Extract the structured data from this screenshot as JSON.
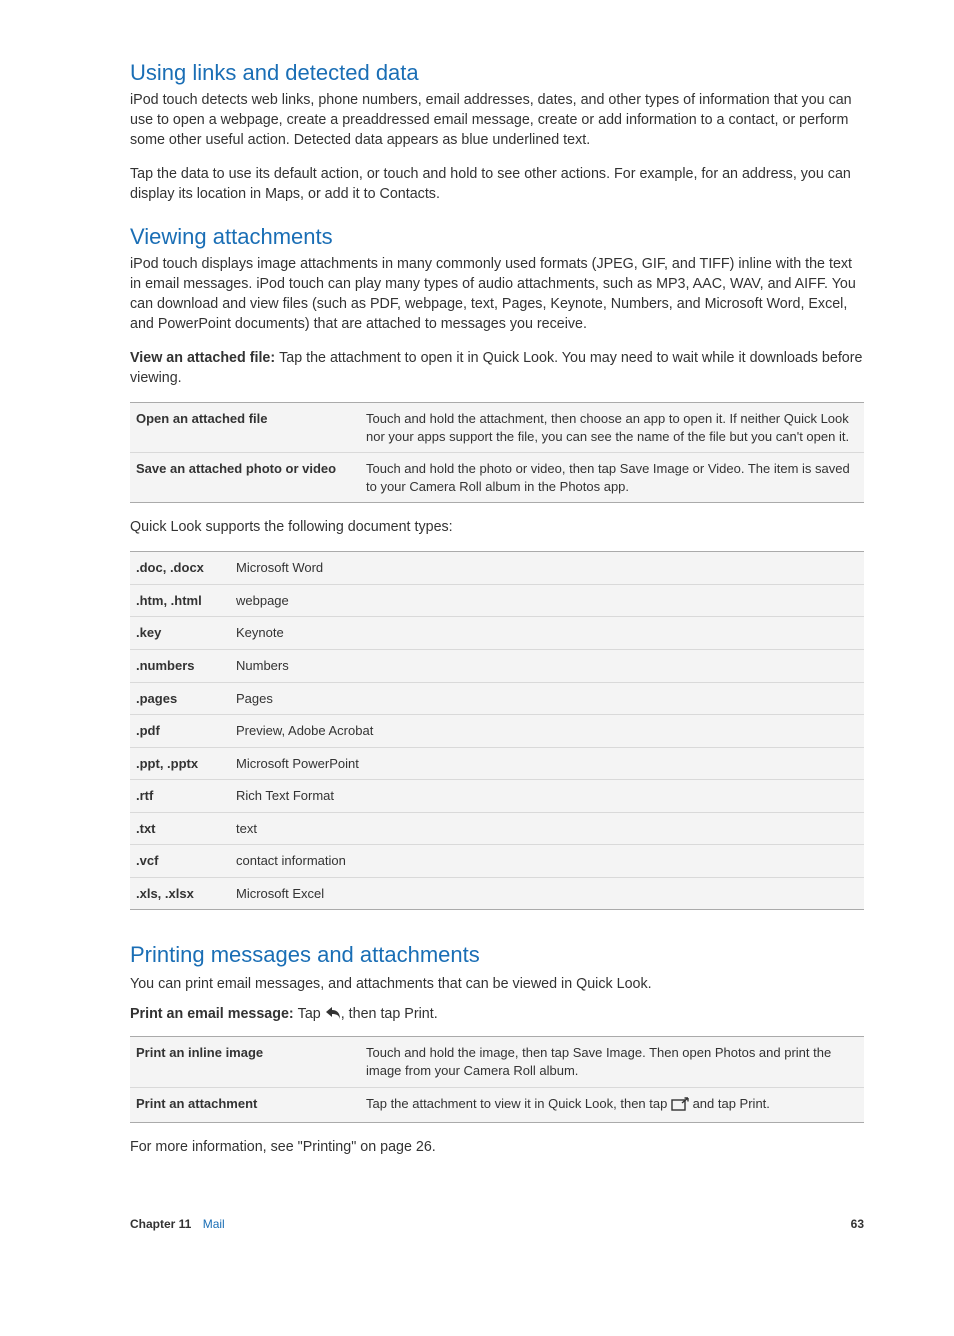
{
  "section1": {
    "heading": "Using links and detected data",
    "p1": "iPod touch detects web links, phone numbers, email addresses, dates, and other types of information that you can use to open a webpage, create a preaddressed email message, create or add information to a contact, or perform some other useful action. Detected data appears as blue underlined text.",
    "p2": "Tap the data to use its default action, or touch and hold to see other actions. For example, for an address, you can display its location in Maps, or add it to Contacts."
  },
  "section2": {
    "heading": "Viewing attachments",
    "p1": "iPod touch displays image attachments in many commonly used formats (JPEG, GIF, and TIFF) inline with the text in email messages. iPod touch can play many types of audio attachments, such as MP3, AAC, WAV, and AIFF. You can download and view files (such as PDF, webpage, text, Pages, Keynote, Numbers, and Microsoft Word, Excel, and PowerPoint documents) that are attached to messages you receive.",
    "view_label": "View an attached file:  ",
    "view_text": "Tap the attachment to open it in Quick Look. You may need to wait while it downloads before viewing.",
    "table": [
      {
        "label": "Open an attached file",
        "desc": "Touch and hold the attachment, then choose an app to open it. If neither Quick Look nor your apps support the file, you can see the name of the file but you can't open it."
      },
      {
        "label": "Save an attached photo or video",
        "desc": "Touch and hold the photo or video, then tap Save Image or Video. The item is saved to your Camera Roll album in the Photos app."
      }
    ],
    "quicklook_intro": "Quick Look supports the following document types:",
    "types": [
      {
        "ext": ".doc, .docx",
        "desc": "Microsoft Word"
      },
      {
        "ext": ".htm, .html",
        "desc": "webpage"
      },
      {
        "ext": ".key",
        "desc": "Keynote"
      },
      {
        "ext": ".numbers",
        "desc": "Numbers"
      },
      {
        "ext": ".pages",
        "desc": "Pages"
      },
      {
        "ext": ".pdf",
        "desc": "Preview, Adobe Acrobat"
      },
      {
        "ext": ".ppt, .pptx",
        "desc": "Microsoft PowerPoint"
      },
      {
        "ext": ".rtf",
        "desc": "Rich Text Format"
      },
      {
        "ext": ".txt",
        "desc": "text"
      },
      {
        "ext": ".vcf",
        "desc": "contact information"
      },
      {
        "ext": ".xls, .xlsx",
        "desc": "Microsoft Excel"
      }
    ]
  },
  "section3": {
    "heading": "Printing messages and attachments",
    "p1": "You can print email messages, and attachments that can be viewed in Quick Look.",
    "print_label": "Print an email message:  ",
    "print_text_before": "Tap ",
    "print_text_after": ", then tap Print.",
    "table": [
      {
        "label": "Print an inline image",
        "desc": "Touch and hold the image, then tap Save Image. Then open Photos and print the image from your Camera Roll album."
      },
      {
        "label": "Print an attachment",
        "desc_before": "Tap the attachment to view it in Quick Look, then tap ",
        "desc_after": " and tap Print."
      }
    ],
    "more_info": "For more information, see \"Printing\" on page 26."
  },
  "footer": {
    "chapter_label": "Chapter 11",
    "chapter_name": "Mail",
    "page": "63"
  }
}
